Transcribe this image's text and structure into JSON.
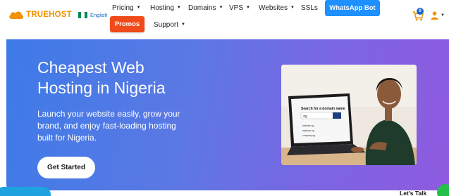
{
  "brand": {
    "name": "TRUEHOST",
    "color": "#f39200"
  },
  "language": {
    "label": "English",
    "flag_colors": [
      "#008751",
      "#ffffff",
      "#008751"
    ]
  },
  "nav": {
    "items": [
      {
        "label": "Pricing",
        "has_dropdown": true
      },
      {
        "label": "Hosting",
        "has_dropdown": true
      },
      {
        "label": "Domains",
        "has_dropdown": true
      },
      {
        "label": "VPS",
        "has_dropdown": true
      },
      {
        "label": "Websites",
        "has_dropdown": true
      },
      {
        "label": "SSLs",
        "has_dropdown": false
      }
    ],
    "whatsapp_label": "WhatsApp Bot",
    "promos_label": "Promos",
    "support_label": "Support",
    "caret": "▼",
    "cart_count": "0"
  },
  "hero": {
    "title": "Cheapest Web Hosting in Nigeria",
    "subtitle": "Launch your website easily, grow your brand, and enjoy fast-loading hosting built for Nigeria.",
    "cta_label": "Get Started",
    "gradient_start": "#3d7be8",
    "gradient_end": "#8f5adf",
    "image": {
      "screen_heading": "Search for a domain name",
      "screen_input": ".ng",
      "screen_results": [
        "website.ng",
        "myshop.ng",
        "company.ng"
      ]
    }
  },
  "chat": {
    "label": "Let's Talk"
  },
  "icons": {
    "cart": "cart-icon",
    "user": "user-icon",
    "logo": "cloud-icon"
  }
}
